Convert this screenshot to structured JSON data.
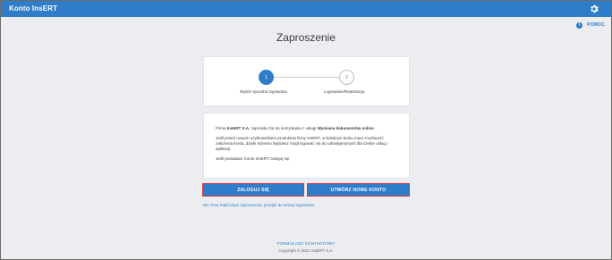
{
  "app": {
    "title": "Konto InsERT"
  },
  "header": {
    "help_label": "POMOC",
    "help_icon_glyph": "i"
  },
  "page": {
    "title": "Zaproszenie"
  },
  "steps": [
    {
      "number": "1",
      "label": "Wybór sposobu logowania",
      "active": true
    },
    {
      "number": "2",
      "label": "Logowanie/Rejestracja",
      "active": false
    }
  ],
  "invitation": {
    "p1_prefix": "Firma ",
    "p1_company": "InsERT S.A.",
    "p1_middle": " zaprosiła Cię do korzystania z usługi ",
    "p1_service": "Wymiana dokumentów online",
    "p1_suffix": ".",
    "p2": "Jeśli jesteś nowym użytkownikiem produktów firmy InsERT, w kolejnym kroku masz możliwość założenia konta, dzięki któremu będziesz mógł logować się do udostępnionych dla Ciebie usług i aplikacji.",
    "p3": "Jeśli posiadasz Konto InsERT zaloguj się."
  },
  "buttons": {
    "login": "ZALOGUJ SIĘ",
    "create": "UTWÓRZ NOWE KONTO"
  },
  "links": {
    "reject": "Nie chcę realizować zaproszenia, przejdź do strony logowania."
  },
  "footer": {
    "contact": "FORMULARZ KONTAKTOWY",
    "copyright": "Copyright © 2021 InsERT S.A."
  },
  "colors": {
    "primary": "#2f7cc9",
    "highlight_border": "#d9343f",
    "background": "#ebedf0"
  }
}
